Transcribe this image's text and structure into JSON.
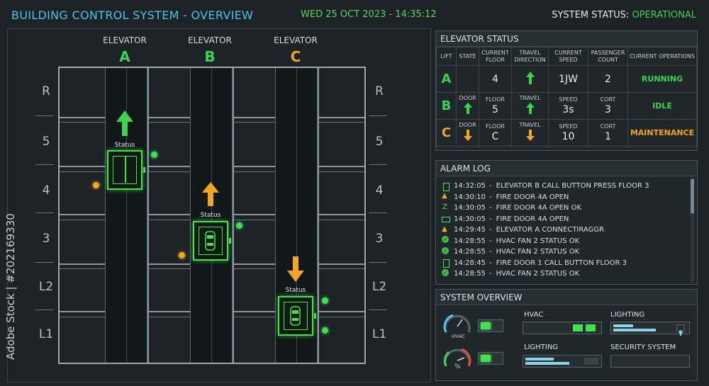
{
  "header": {
    "title": "BUILDING CONTROL SYSTEM - OVERVIEW",
    "datetime": "WED 25 OCT 2023 - 14:35:12",
    "status_label": "SYSTEM STATUS:",
    "status_value": "OPERATIONAL"
  },
  "watermark": "Adobe Stock | #202169330",
  "shafts": [
    {
      "name": "ELEVATOR",
      "letter": "A",
      "color": "#3fd24f"
    },
    {
      "name": "ELEVATOR",
      "letter": "B",
      "color": "#3fd24f"
    },
    {
      "name": "ELEVATOR",
      "letter": "C",
      "color": "#f2a525"
    }
  ],
  "floors": [
    "R",
    "5",
    "4",
    "3",
    "L2",
    "L1"
  ],
  "cars": [
    {
      "label": "Status",
      "direction": "up",
      "arrow_color": "#3fd24f",
      "icon": "elevator-doors-icon"
    },
    {
      "label": "Status",
      "direction": "up",
      "arrow_color": "#f2a525",
      "icon": "car-icon"
    },
    {
      "label": "Status",
      "direction": "down",
      "arrow_color": "#f2a525",
      "icon": "car-icon"
    }
  ],
  "elevator_status": {
    "title": "ELEVATOR STATUS",
    "columns": [
      "LIFT",
      "STATE",
      "CURRENT FLOOR",
      "TRAVEL DIRECTION",
      "CURRENT SPEED",
      "PASSENGER COUNT",
      "CURRENT OPERATIONS"
    ],
    "rows": [
      {
        "lift": "A",
        "lift_color": "#3fd24f",
        "state_label": "",
        "state_icon": "",
        "floor_label": "",
        "floor": "4",
        "travel_label": "",
        "travel": "up",
        "travel_color": "#3fd24f",
        "speed_label": "",
        "speed": "1JW",
        "count_label": "",
        "count": "2",
        "op": "RUNNING",
        "op_color": "#3fd24f"
      },
      {
        "lift": "B",
        "lift_color": "#3fd24f",
        "state_label": "DOOR",
        "state_icon": "up",
        "state_color": "#3fd24f",
        "floor_label": "FLOOR",
        "floor": "5",
        "travel_label": "TRAVEL",
        "travel": "up",
        "travel_color": "#3fd24f",
        "speed_label": "SPEED",
        "speed": "3s",
        "count_label": "CORT",
        "count": "3",
        "op": "IDLE",
        "op_color": "#3fd24f"
      },
      {
        "lift": "C",
        "lift_color": "#f2a525",
        "state_label": "DOOR",
        "state_icon": "down",
        "state_color": "#f2a525",
        "floor_label": "FLOOR",
        "floor": "C",
        "travel_label": "TRAVEL",
        "travel": "down",
        "travel_color": "#f2a525",
        "speed_label": "SPEED",
        "speed": "10",
        "count_label": "CORT",
        "count": "1",
        "op": "MAINTENANCE",
        "op_color": "#f2a525"
      }
    ]
  },
  "alarm_log": {
    "title": "ALARM LOG",
    "entries": [
      {
        "icon": "batt",
        "time": "14:32:05",
        "text": "ELEVATOR B CALL BUTTON PRESS FLOOR 3"
      },
      {
        "icon": "warn",
        "time": "14:30:10",
        "text": "FIRE DOOR 4A OPEN"
      },
      {
        "icon": "zig",
        "time": "14:30:05",
        "text": "FIRE DOOR 4A OPEN OK"
      },
      {
        "icon": "rect",
        "time": "14:30:05",
        "text": "FIRE DOOR 4A OPEN"
      },
      {
        "icon": "warn",
        "time": "14:29:45",
        "text": "ELEVATOR A CONNECTIRAGGR"
      },
      {
        "icon": "ok",
        "time": "14:28:55",
        "text": "HVAC FAN 2 STATUS OK"
      },
      {
        "icon": "ok",
        "time": "14:28:55",
        "text": "HVAC FAN 2 STATUS OK"
      },
      {
        "icon": "batt",
        "time": "14:28:45",
        "text": "FIRE DOOR 1 CALL BUTTON FLOOR 3"
      },
      {
        "icon": "ok",
        "time": "14:28:55",
        "text": "HVAC FAN 2 STATUS OK"
      }
    ]
  },
  "system_overview": {
    "title": "SYSTEM OVERVIEW",
    "gauge1_label": "HVAC",
    "gauge2_label": "%",
    "hvac_label": "HVAC",
    "lighting_label_1": "LIGHTING",
    "lighting_label_2": "LIGHTING",
    "security_label": "SECURITY SYSTEM"
  }
}
